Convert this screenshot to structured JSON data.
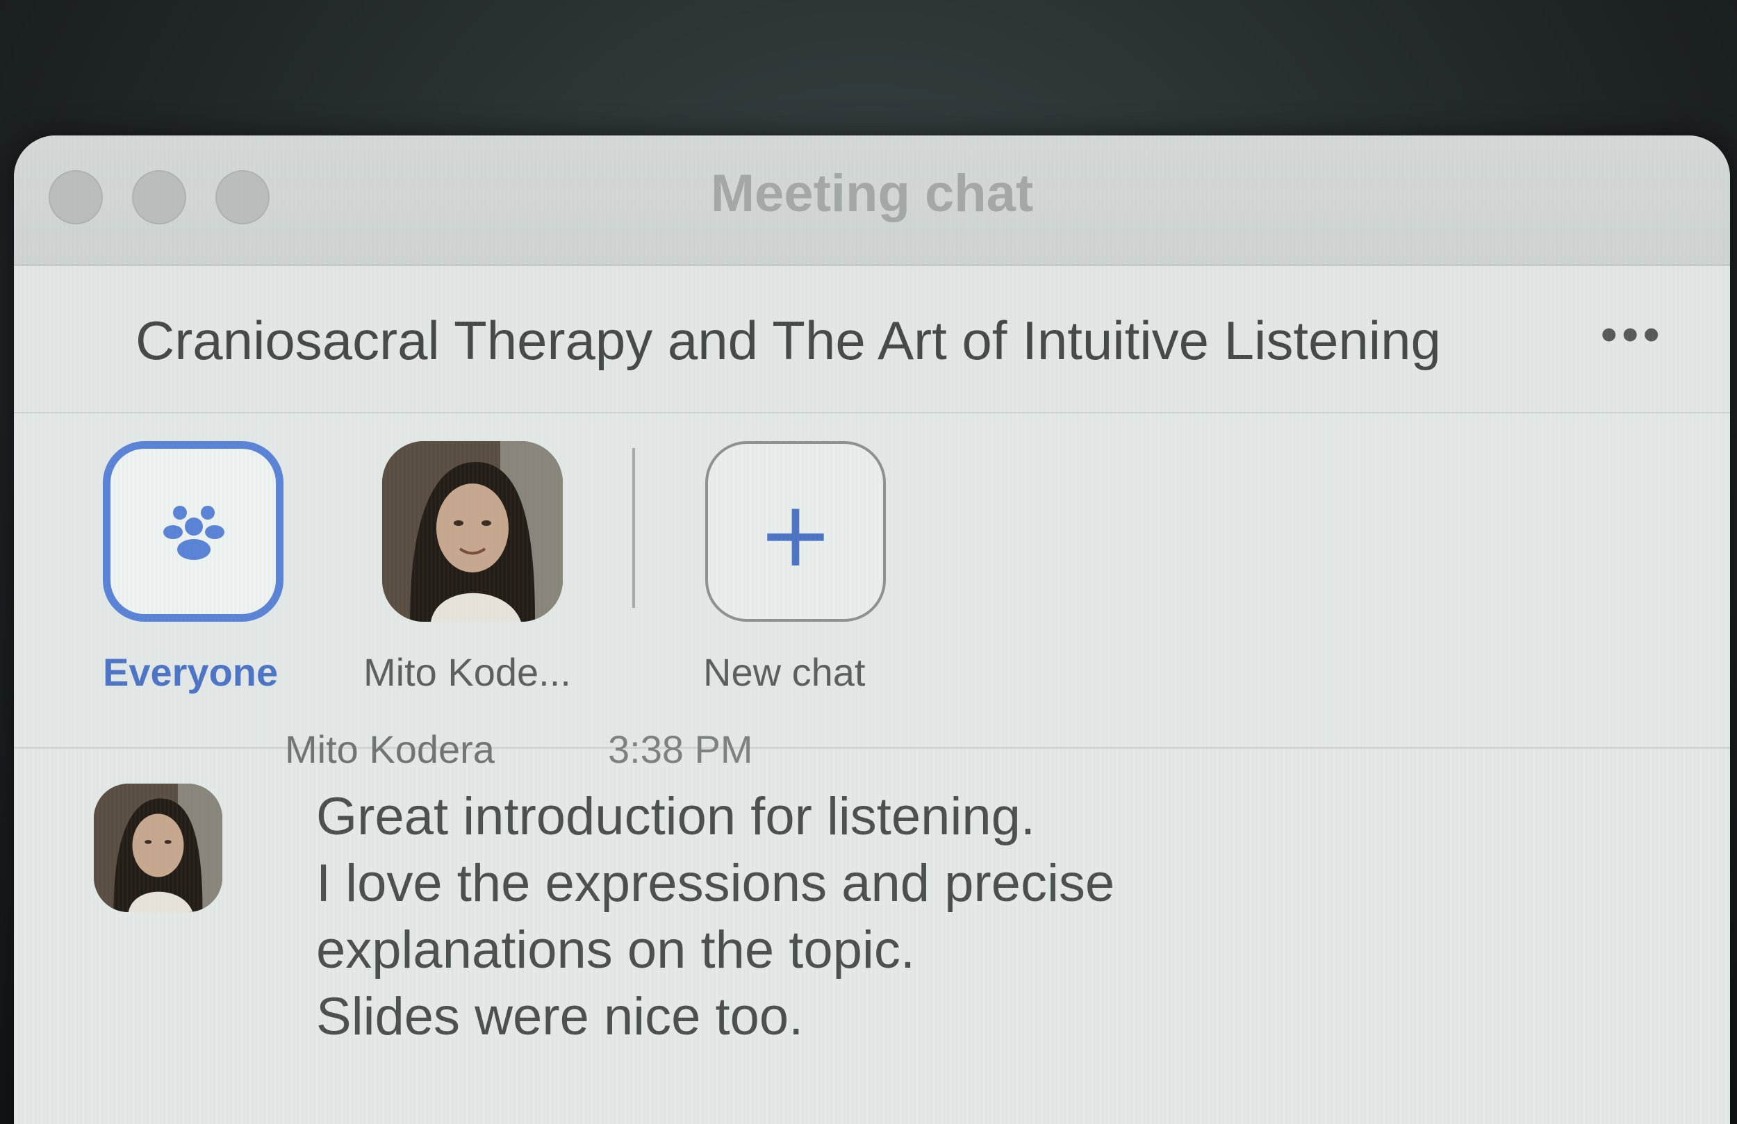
{
  "window": {
    "title": "Meeting chat"
  },
  "header": {
    "meeting_title": "Craniosacral Therapy and The Art of Intuitive Listening",
    "more_label": "•••"
  },
  "recipients": {
    "everyone_label": "Everyone",
    "mito_label": "Mito Kode...",
    "new_chat_label": "New chat",
    "new_chat_icon": "+"
  },
  "message": {
    "sender": "Mito Kodera",
    "time": "3:38 PM",
    "lines": [
      "Great introduction for listening.",
      "I love the expressions and precise",
      "explanations on the topic.",
      "Slides were nice too."
    ]
  },
  "colors": {
    "accent": "#5a82d6",
    "window_bg": "#e3e8e6"
  },
  "icons": {
    "everyone": "people-group-icon",
    "more": "more-options-icon",
    "new_chat": "plus-icon"
  }
}
